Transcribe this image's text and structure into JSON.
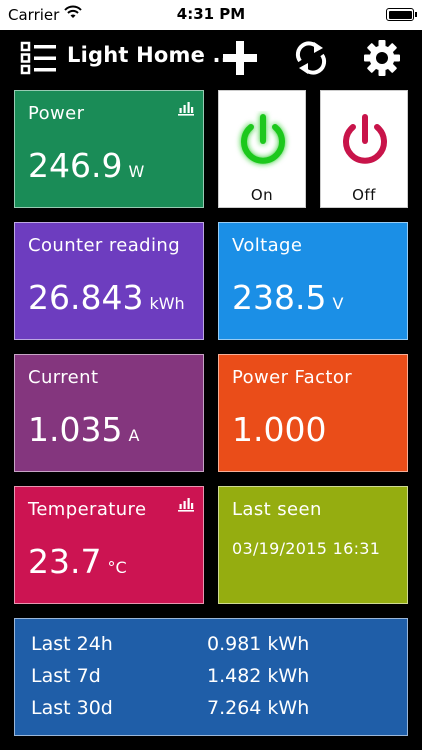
{
  "status_bar": {
    "carrier": "Carrier",
    "time": "4:31 PM"
  },
  "nav": {
    "title": "Light Home ..."
  },
  "colors": {
    "power": "#1a8c57",
    "counter": "#6d3dbf",
    "voltage": "#1b8fe6",
    "current": "#84367e",
    "power_factor": "#ea4d19",
    "temperature": "#cc1452",
    "last_seen": "#95ad10",
    "history": "#1f5ea8",
    "on_green": "#1ec81e",
    "off_red": "#c8144a"
  },
  "tiles": {
    "power": {
      "label": "Power",
      "value": "246.9",
      "unit": "W"
    },
    "counter": {
      "label": "Counter reading",
      "value": "26.843",
      "unit": "kWh"
    },
    "voltage": {
      "label": "Voltage",
      "value": "238.5",
      "unit": "V"
    },
    "current": {
      "label": "Current",
      "value": "1.035",
      "unit": "A"
    },
    "power_factor": {
      "label": "Power Factor",
      "value": "1.000"
    },
    "temperature": {
      "label": "Temperature",
      "value": "23.7",
      "unit": "°C"
    },
    "last_seen": {
      "label": "Last seen",
      "value": "03/19/2015 16:31"
    }
  },
  "switches": {
    "on": {
      "label": "On"
    },
    "off": {
      "label": "Off"
    }
  },
  "history": [
    {
      "period": "Last 24h",
      "amount": "0.981 kWh"
    },
    {
      "period": "Last 7d",
      "amount": "1.482 kWh"
    },
    {
      "period": "Last 30d",
      "amount": "7.264 kWh"
    }
  ]
}
